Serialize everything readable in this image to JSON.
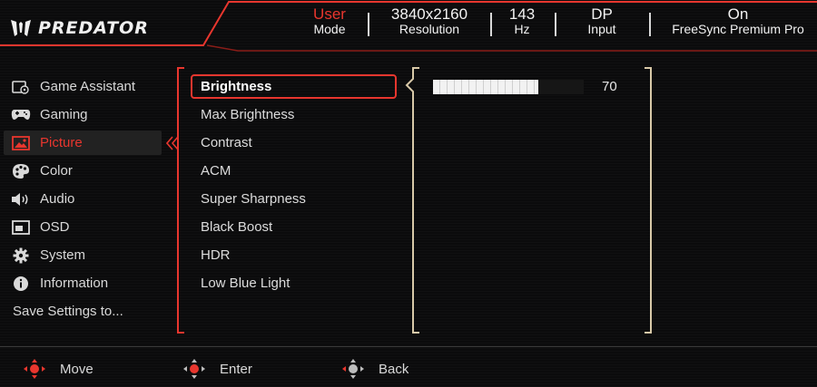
{
  "brand": {
    "name": "PREDATOR",
    "logo_icon": "predator-claw-icon"
  },
  "status": {
    "mode": {
      "value": "User",
      "label": "Mode"
    },
    "resolution": {
      "value": "3840x2160",
      "label": "Resolution"
    },
    "refresh": {
      "value": "143",
      "label": "Hz"
    },
    "input": {
      "value": "DP",
      "label": "Input"
    },
    "freesync": {
      "value": "On",
      "label": "FreeSync Premium Pro"
    }
  },
  "menu": {
    "items": [
      {
        "label": "Game Assistant",
        "icon": "game-assistant-icon"
      },
      {
        "label": "Gaming",
        "icon": "gamepad-icon"
      },
      {
        "label": "Picture",
        "icon": "picture-icon",
        "active": true
      },
      {
        "label": "Color",
        "icon": "palette-icon"
      },
      {
        "label": "Audio",
        "icon": "speaker-icon"
      },
      {
        "label": "OSD",
        "icon": "osd-icon"
      },
      {
        "label": "System",
        "icon": "gear-icon"
      },
      {
        "label": "Information",
        "icon": "info-icon"
      }
    ],
    "save_label": "Save Settings to..."
  },
  "submenu": {
    "items": [
      {
        "label": "Brightness",
        "selected": true
      },
      {
        "label": "Max Brightness"
      },
      {
        "label": "Contrast"
      },
      {
        "label": "ACM"
      },
      {
        "label": "Super Sharpness"
      },
      {
        "label": "Black Boost"
      },
      {
        "label": "HDR"
      },
      {
        "label": "Low Blue Light"
      }
    ]
  },
  "brightness": {
    "value": 70,
    "value_text": "70",
    "level_fraction": 0.7
  },
  "footer": {
    "move_label": "Move",
    "enter_label": "Enter",
    "back_label": "Back"
  },
  "colors": {
    "accent": "#e8362e",
    "text": "#e6e6e6",
    "background": "#0b0b0c"
  }
}
